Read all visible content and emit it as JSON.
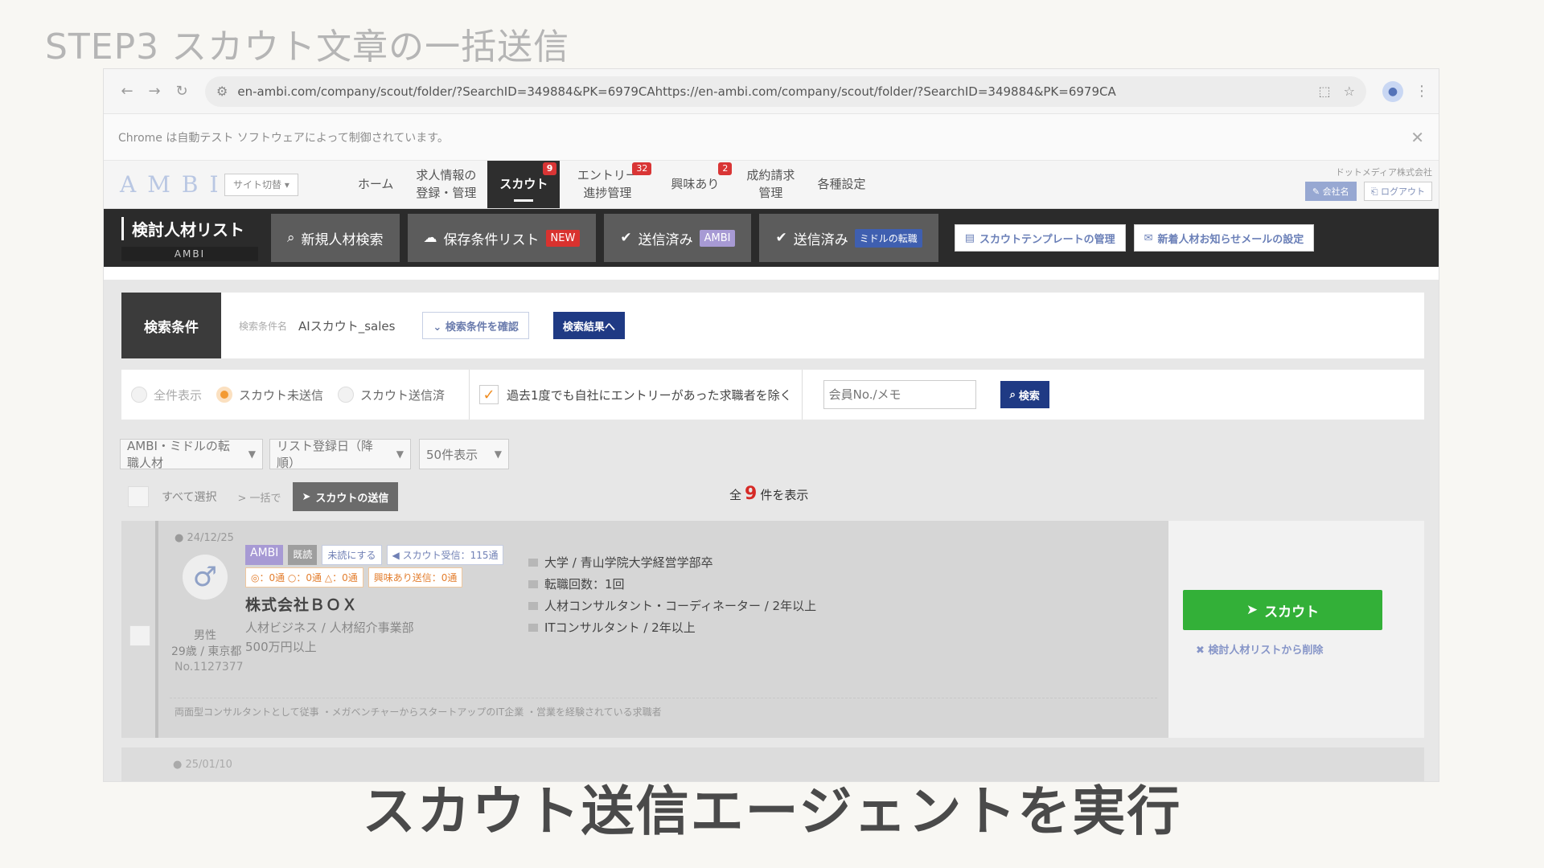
{
  "step_title": "STEP3 スカウト文章の一括送信",
  "caption": "スカウト送信エージェントを実行",
  "browser": {
    "back": "←",
    "forward": "→",
    "reload": "↻",
    "site_info": "⚙",
    "url": "en-ambi.com/company/scout/folder/?SearchID=349884&PK=6979CAhttps://en-ambi.com/company/scout/folder/?SearchID=349884&PK=6979CA",
    "install_icon": "⬚",
    "star_icon": "☆",
    "profile_icon": "●",
    "menu_icon": "⋮",
    "infobar_text": "Chrome は自動テスト ソフトウェアによって制御されています。",
    "close_icon": "✕"
  },
  "header": {
    "logo": "AMBI",
    "site_switch": "サイト切替 ▾",
    "nav": [
      {
        "label": "ホーム",
        "badge": ""
      },
      {
        "label": "求人情報の\n登録・管理",
        "badge": ""
      },
      {
        "label": "スカウト",
        "badge": "9"
      },
      {
        "label": "エントリー\n進捗管理",
        "badge": "32"
      },
      {
        "label": "興味あり",
        "badge": "2"
      },
      {
        "label": "成約請求\n管理",
        "badge": ""
      },
      {
        "label": "各種設定",
        "badge": ""
      }
    ],
    "company": "ドットメディア株式会社",
    "company_btn": "✎ 会社名",
    "logout_btn": "⎗ ログアウト"
  },
  "tabbar": {
    "title": "検討人材リスト",
    "subtitle": "AMBI",
    "tabs": [
      {
        "icon": "⌕",
        "label": "新規人材検索",
        "badge": ""
      },
      {
        "icon": "☁",
        "label": "保存条件リスト",
        "badge": "NEW"
      },
      {
        "icon": "✔",
        "label": "送信済み",
        "badge": "AMBI"
      },
      {
        "icon": "✔",
        "label": "送信済み",
        "badge": "ミドルの転職"
      }
    ],
    "template_btn": "スカウトテンプレートの管理",
    "mail_btn": "新着人材お知らせメールの設定"
  },
  "search_conditions": {
    "label": "検索条件",
    "name_label": "検索条件名",
    "name": "AIスカウト_sales",
    "confirm_btn": "⌄ 検索条件を確認",
    "results_btn": "検索結果へ"
  },
  "filters": {
    "radios": [
      "全件表示",
      "スカウト未送信",
      "スカウト送信済"
    ],
    "exclude_label": "過去1度でも自社にエントリーがあった求職者を除く",
    "member_placeholder": "会員No./メモ",
    "search_btn": "検索"
  },
  "selects": {
    "source": "AMBI・ミドルの転職人材",
    "sort": "リスト登録日（降順）",
    "per_page": "50件表示"
  },
  "bulk": {
    "select_all": "すべて選択",
    "bulk_label": "> 一括で",
    "scout_send": "スカウトの送信",
    "count_prefix": "全",
    "count": "9",
    "count_suffix": "件を表示"
  },
  "candidate": {
    "date": "● 24/12/25",
    "gender": "男性",
    "age_loc": "29歳 / 東京都",
    "member_no": "No.1127377",
    "badges": {
      "ambi": "AMBI",
      "resume": "既読",
      "unread": "未読にする",
      "received": "◀ スカウト受信：115通"
    },
    "stats": [
      "◎：0通 ○：0通 △：0通",
      "興味あり送信：0通"
    ],
    "company": "株式会社ＢＯＸ",
    "industry": "人材ビジネス / 人材紹介事業部",
    "salary": "500万円以上",
    "details": [
      "大学 / 青山学院大学経営学部卒",
      "転職回数：1回",
      "人材コンサルタント・コーディネーター / 2年以上",
      "ITコンサルタント / 2年以上"
    ],
    "note": "両面型コンサルタントとして従事 ・メガベンチャーからスタートアップのIT企業 ・営業を経験されている求職者",
    "scout_btn": "スカウト",
    "remove_link": "✖ 検討人材リストから削除"
  },
  "candidate2": {
    "date": "● 25/01/10"
  }
}
